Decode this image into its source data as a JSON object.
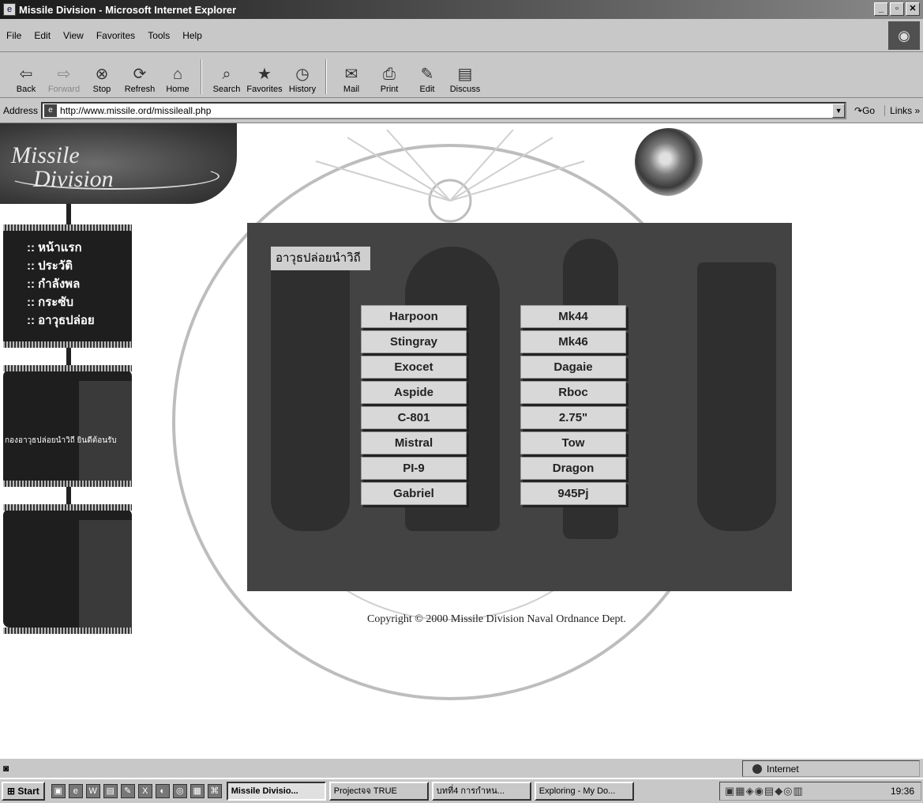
{
  "window": {
    "title": "Missile Division - Microsoft Internet Explorer",
    "controls": [
      "_",
      "▫",
      "✕"
    ]
  },
  "menu": [
    "File",
    "Edit",
    "View",
    "Favorites",
    "Tools",
    "Help"
  ],
  "toolbar": {
    "buttons": [
      {
        "label": "Back",
        "icon": "back-arrow-icon",
        "glyph": "⇦"
      },
      {
        "label": "Forward",
        "icon": "forward-arrow-icon",
        "glyph": "⇨"
      },
      {
        "label": "Stop",
        "icon": "stop-icon",
        "glyph": "⊗"
      },
      {
        "label": "Refresh",
        "icon": "refresh-icon",
        "glyph": "⟳"
      },
      {
        "label": "Home",
        "icon": "home-icon",
        "glyph": "⌂"
      },
      {
        "label": "Search",
        "icon": "search-icon",
        "glyph": "⌕"
      },
      {
        "label": "Favorites",
        "icon": "favorites-icon",
        "glyph": "★"
      },
      {
        "label": "History",
        "icon": "history-icon",
        "glyph": "◷"
      },
      {
        "label": "Mail",
        "icon": "mail-icon",
        "glyph": "✉"
      },
      {
        "label": "Print",
        "icon": "print-icon",
        "glyph": "⎙"
      },
      {
        "label": "Edit",
        "icon": "edit-icon",
        "glyph": "✎"
      },
      {
        "label": "Discuss",
        "icon": "discuss-icon",
        "glyph": "▤"
      }
    ]
  },
  "address": {
    "label": "Address",
    "url": "http://www.missile.ord/missileall.php",
    "go_label": "Go",
    "links_label": "Links »"
  },
  "page": {
    "logo": {
      "line1": "Missile",
      "line2": "Division"
    },
    "nav": [
      ":: หน้าแรก",
      ":: ประวัติ",
      ":: กำลังพล",
      ":: กระซับ",
      ":: อาวุธปล่อย"
    ],
    "info_text": "กองอาวุธปล่อยนำวิถี ยินดีต้อนรับ",
    "panel_title": "อาวุธปล่อยนำวิถี",
    "weapons_left": [
      "Harpoon",
      "Stingray",
      "Exocet",
      "Aspide",
      "C-801",
      "Mistral",
      "PI-9",
      "Gabriel"
    ],
    "weapons_right": [
      "Mk44",
      "Mk46",
      "Dagaie",
      "Rboc",
      "2.75\"",
      "Tow",
      "Dragon",
      "945Pj"
    ],
    "copyright": "Copyright © 2000 Missile Division Naval Ordnance Dept."
  },
  "statusbar": {
    "zone": "Internet"
  },
  "taskbar": {
    "start_label": "Start",
    "tasks": [
      {
        "label": "Missile Divisio...",
        "active": true
      },
      {
        "label": "Projectจจ TRUE",
        "active": false
      },
      {
        "label": "บทที่4 การกำหน...",
        "active": false
      },
      {
        "label": "Exploring - My Do...",
        "active": false
      }
    ],
    "clock": "19:36"
  },
  "colors": {
    "chrome": "#c8c8c8",
    "panel": "#434343",
    "nav_bg": "#1e1e1e",
    "button": "#d8d8d8"
  }
}
